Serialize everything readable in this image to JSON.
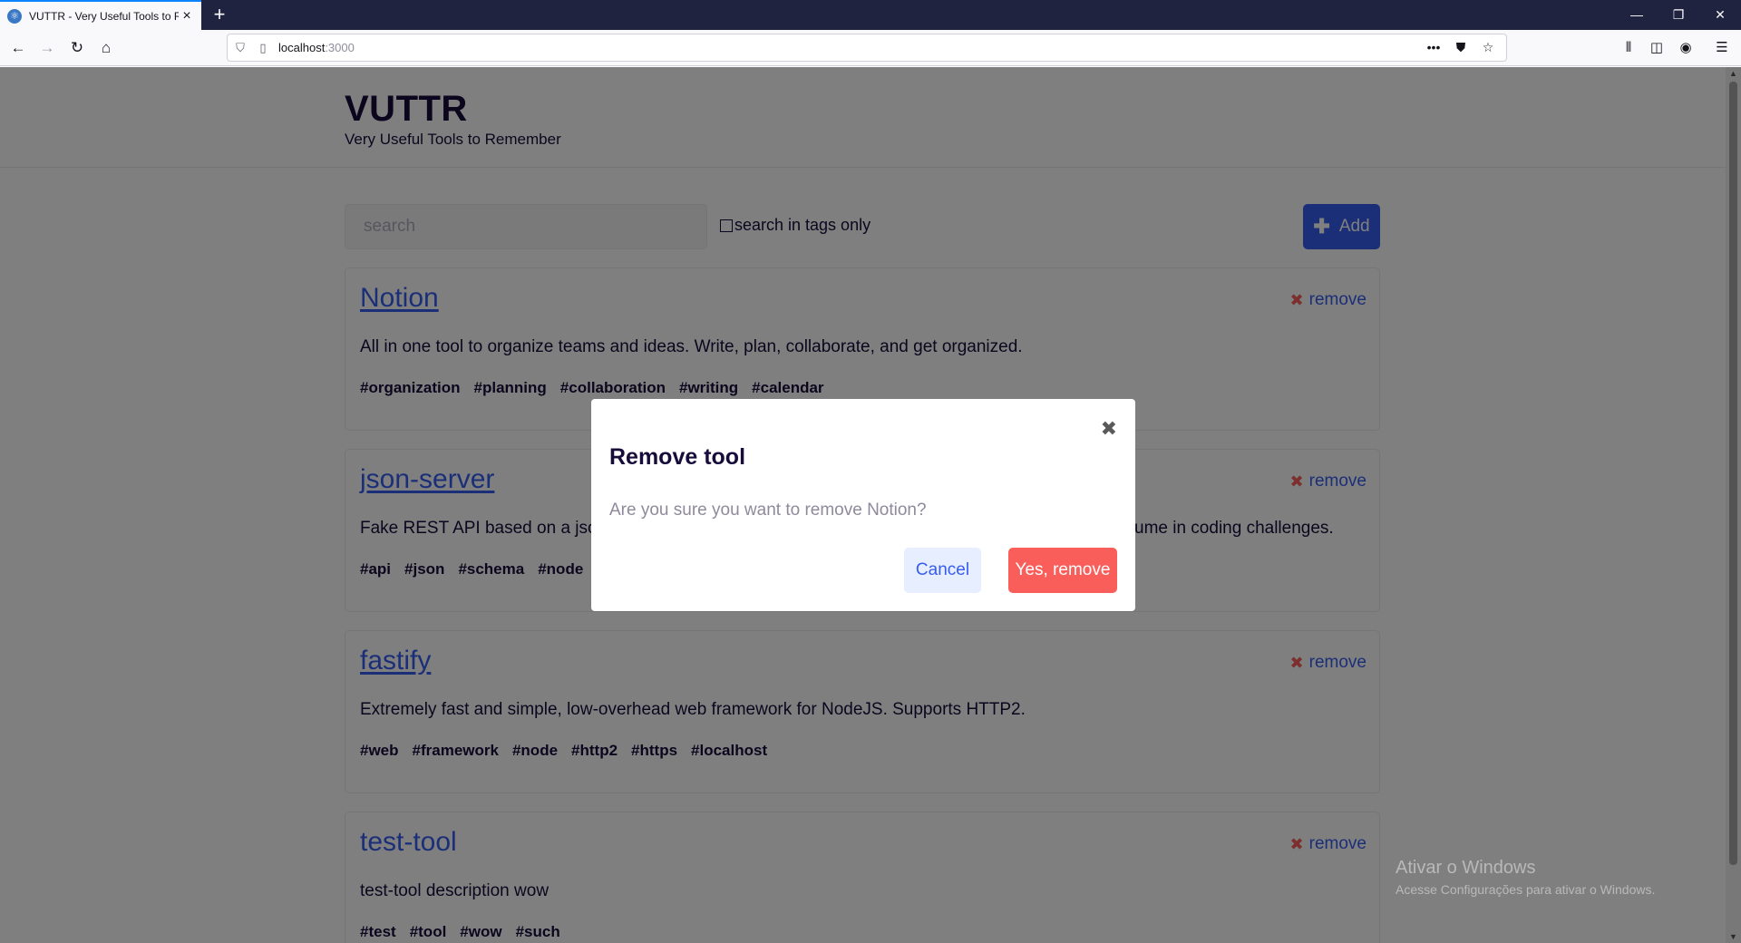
{
  "browser": {
    "tab_title": "VUTTR - Very Useful Tools to Re",
    "url_host": "localhost",
    "url_port": ":3000"
  },
  "header": {
    "title": "VUTTR",
    "subtitle": "Very Useful Tools to Remember"
  },
  "controls": {
    "search_placeholder": "search",
    "tags_only_label": "search in tags only",
    "tags_only_checked": false,
    "add_label": "Add"
  },
  "tools": [
    {
      "title": "Notion",
      "description": "All in one tool to organize teams and ideas. Write, plan, collaborate, and get organized.",
      "tags": [
        "#organization",
        "#planning",
        "#collaboration",
        "#writing",
        "#calendar"
      ],
      "remove_label": "remove"
    },
    {
      "title": "json-server",
      "description": "Fake REST API based on a json",
      "description_tail": "ume in coding challenges.",
      "tags": [
        "#api",
        "#json",
        "#schema",
        "#node"
      ],
      "remove_label": "remove"
    },
    {
      "title": "fastify",
      "description": "Extremely fast and simple, low-overhead web framework for NodeJS. Supports HTTP2.",
      "tags": [
        "#web",
        "#framework",
        "#node",
        "#http2",
        "#https",
        "#localhost"
      ],
      "remove_label": "remove"
    },
    {
      "title": "test-tool",
      "description": "test-tool description wow",
      "tags": [
        "#test",
        "#tool",
        "#wow",
        "#such"
      ],
      "remove_label": "remove"
    }
  ],
  "modal": {
    "title": "Remove tool",
    "message": "Are you sure you want to remove Notion?",
    "cancel_label": "Cancel",
    "confirm_label": "Yes, remove"
  },
  "watermark": {
    "title": "Ativar o Windows",
    "subtitle": "Acesse Configurações para ativar o Windows."
  },
  "colors": {
    "primary": "#365df0",
    "danger": "#f95e5a",
    "text": "#170c3a"
  }
}
